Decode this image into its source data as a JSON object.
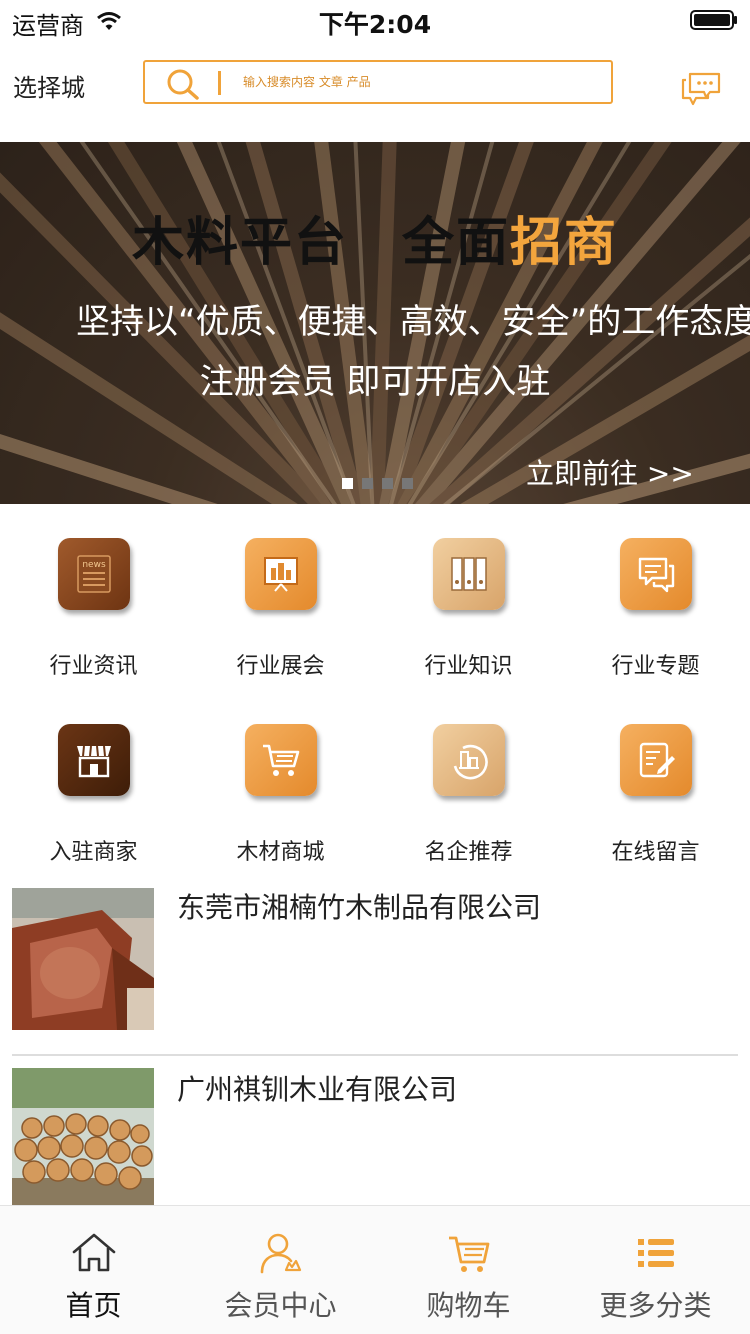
{
  "status_bar": {
    "carrier": "运营商",
    "time": "下午2:04"
  },
  "header": {
    "city": "选择城",
    "search_placeholder": "输入搜索内容 文章 产品"
  },
  "banner": {
    "title_black": "木料平台　全面",
    "title_orange": "招商",
    "line1": "坚持以“优质、便捷、高效、安全”的工作态度",
    "line2": "注册会员  即可开店入驻",
    "cta": "立即前往 >>",
    "slide_count": 4,
    "active_slide": 1
  },
  "grid": [
    {
      "label": "行业资讯",
      "icon": "news-icon"
    },
    {
      "label": "行业展会",
      "icon": "exhibition-icon"
    },
    {
      "label": "行业知识",
      "icon": "knowledge-icon"
    },
    {
      "label": "行业专题",
      "icon": "topic-icon"
    },
    {
      "label": "入驻商家",
      "icon": "store-icon"
    },
    {
      "label": "木材商城",
      "icon": "cart-icon"
    },
    {
      "label": "名企推荐",
      "icon": "enterprise-icon"
    },
    {
      "label": "在线留言",
      "icon": "message-edit-icon"
    }
  ],
  "companies": [
    {
      "name": "东莞市湘楠竹木制品有限公司"
    },
    {
      "name": "广州祺钏木业有限公司"
    }
  ],
  "tabs": [
    {
      "label": "首页",
      "icon": "home-icon",
      "active": true
    },
    {
      "label": "会员中心",
      "icon": "user-icon",
      "active": false
    },
    {
      "label": "购物车",
      "icon": "shopping-cart-icon",
      "active": false
    },
    {
      "label": "更多分类",
      "icon": "list-icon",
      "active": false
    }
  ],
  "colors": {
    "accent": "#f0a33a",
    "banner_highlight": "#f3a53d"
  }
}
